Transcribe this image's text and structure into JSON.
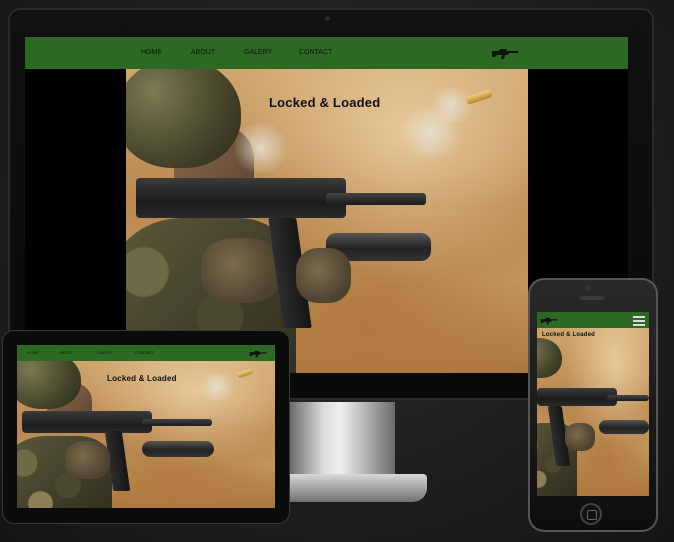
{
  "brand": {
    "nav_green": "#2c6a23",
    "title_color": "#101010"
  },
  "site": {
    "hero_title": "Locked & Loaded",
    "nav": [
      {
        "label": "HOME"
      },
      {
        "label": "ABOUT"
      },
      {
        "label": "GALERY"
      },
      {
        "label": "CONTACT"
      }
    ],
    "logo_icon": "rifle-icon",
    "menu_icon": "hamburger-icon"
  }
}
